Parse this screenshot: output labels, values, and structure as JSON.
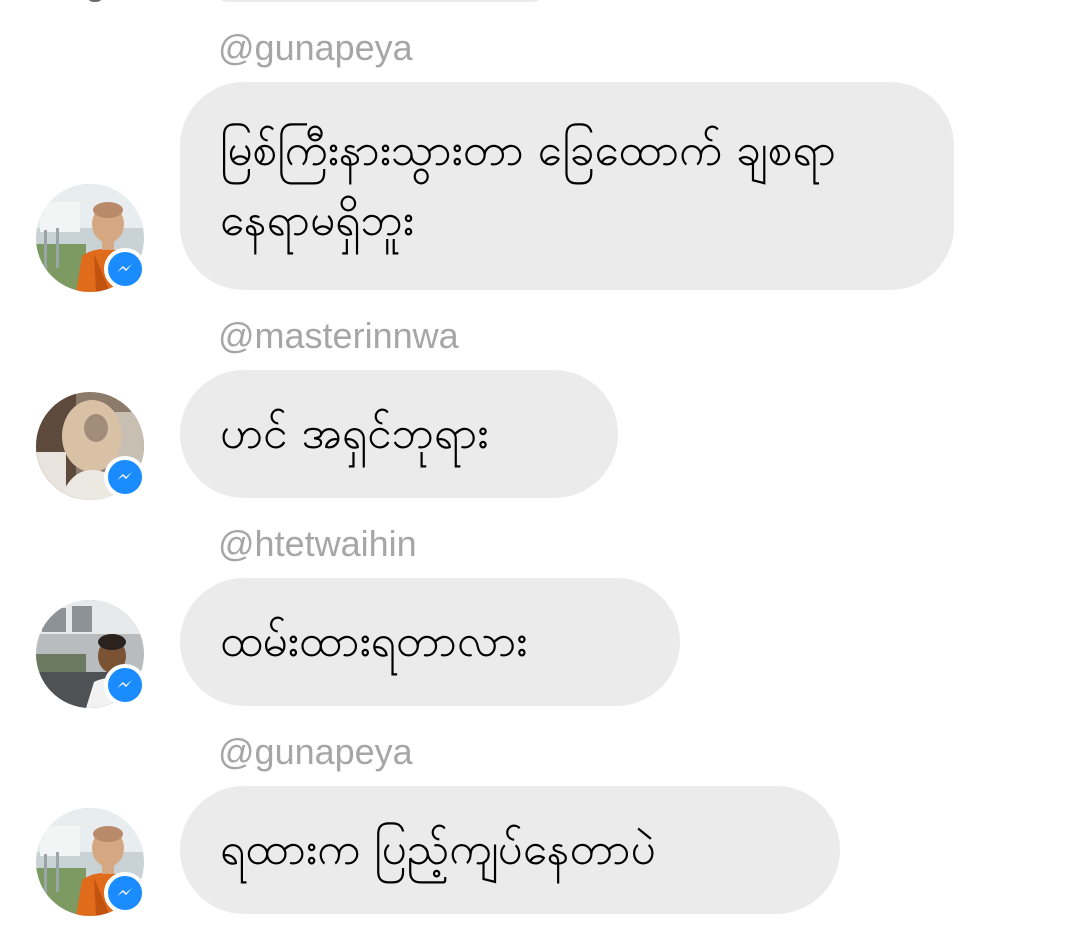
{
  "messages": [
    {
      "sender": "@gunapeya",
      "text": "မြစ်ကြီးနားသွားတာ ခြေထောက် ချစရာနေရာမရှိဘူး",
      "avatar": "monk-avatar"
    },
    {
      "sender": "@masterinnwa",
      "text": "ဟင် အရှင်ဘုရား",
      "avatar": "shaved-head-avatar"
    },
    {
      "sender": "@htetwaihin",
      "text": "ထမ်းထားရတာလား",
      "avatar": "young-man-avatar"
    },
    {
      "sender": "@gunapeya",
      "text": "ရထားက ပြည့်ကျပ်နေတာပဲ",
      "avatar": "monk-avatar"
    }
  ],
  "colors": {
    "bubble": "#ebebeb",
    "sender": "#a6a6a6",
    "badge": "#1a8cff"
  },
  "badge_icon": "messenger-icon"
}
